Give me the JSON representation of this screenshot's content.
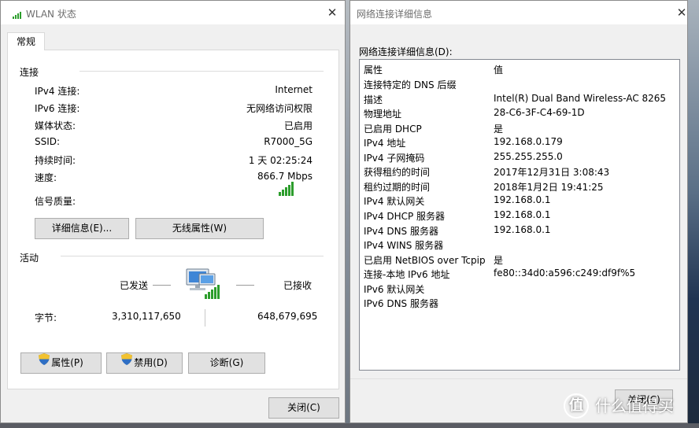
{
  "status_window": {
    "title": "WLAN 状态",
    "tab": "常规",
    "connection": {
      "heading": "连接",
      "rows": [
        {
          "label": "IPv4 连接:",
          "value": "Internet"
        },
        {
          "label": "IPv6 连接:",
          "value": "无网络访问权限"
        },
        {
          "label": "媒体状态:",
          "value": "已启用"
        },
        {
          "label": "SSID:",
          "value": "R7000_5G"
        },
        {
          "label": "持续时间:",
          "value": "1 天 02:25:24"
        },
        {
          "label": "速度:",
          "value": "866.7 Mbps"
        }
      ],
      "signal_label": "信号质量:",
      "signal_icon": "signal-bars-icon",
      "signal_bars_filled": 5,
      "signal_bars_total": 5
    },
    "buttons": {
      "details": "详细信息(E)...",
      "wireless_props": "无线属性(W)"
    },
    "activity": {
      "heading": "活动",
      "sent_label": "已发送",
      "received_label": "已接收",
      "bytes_label": "字节:",
      "bytes_sent": "3,310,117,650",
      "bytes_received": "648,679,695",
      "icon": "network-computer-icon"
    },
    "actions": {
      "properties": "属性(P)",
      "disable": "禁用(D)",
      "diagnose": "诊断(G)",
      "shield_icon": "uac-shield-icon"
    },
    "close": "关闭(C)"
  },
  "details_window": {
    "title": "网络连接详细信息",
    "list_label": "网络连接详细信息(D):",
    "columns": {
      "property": "属性",
      "value": "值"
    },
    "rows": [
      {
        "property": "连接特定的 DNS 后缀",
        "value": ""
      },
      {
        "property": "描述",
        "value": "Intel(R) Dual Band Wireless-AC 8265"
      },
      {
        "property": "物理地址",
        "value": "28-C6-3F-C4-69-1D"
      },
      {
        "property": "已启用 DHCP",
        "value": "是"
      },
      {
        "property": "IPv4 地址",
        "value": "192.168.0.179"
      },
      {
        "property": "IPv4 子网掩码",
        "value": "255.255.255.0"
      },
      {
        "property": "获得租约的时间",
        "value": "2017年12月31日 3:08:43"
      },
      {
        "property": "租约过期的时间",
        "value": "2018年1月2日 19:41:25"
      },
      {
        "property": "IPv4 默认网关",
        "value": "192.168.0.1"
      },
      {
        "property": "IPv4 DHCP 服务器",
        "value": "192.168.0.1"
      },
      {
        "property": "IPv4 DNS 服务器",
        "value": "192.168.0.1"
      },
      {
        "property": "IPv4 WINS 服务器",
        "value": ""
      },
      {
        "property": "已启用 NetBIOS over Tcpip",
        "value": "是"
      },
      {
        "property": "连接-本地 IPv6 地址",
        "value": "fe80::34d0:a596:c249:df9f%5"
      },
      {
        "property": "IPv6 默认网关",
        "value": ""
      },
      {
        "property": "IPv6 DNS 服务器",
        "value": ""
      }
    ],
    "close": "关闭(C)"
  },
  "watermark": {
    "badge": "值",
    "text": "什么值得买"
  },
  "colors": {
    "signal_green": "#2c9d2c",
    "window_bg": "#f0f0f0",
    "button_bg": "#e1e1e1"
  }
}
